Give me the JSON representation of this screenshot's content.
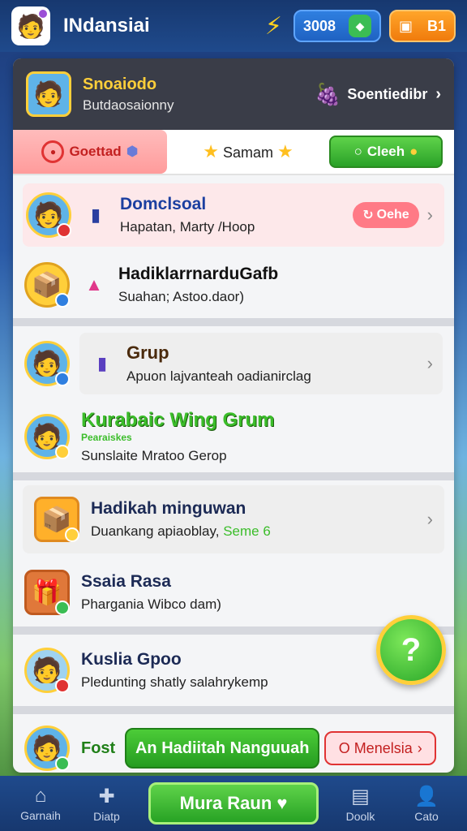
{
  "header": {
    "title": "INdansiai",
    "coins": "3008",
    "stars": "B1"
  },
  "profile": {
    "name": "Snoaiodo",
    "subtitle": "Butdaosaionny",
    "right_label": "Soentiedibr"
  },
  "tabs": {
    "active": "Goettad",
    "middle": "Samam",
    "button": "Cleeh"
  },
  "rows": [
    {
      "title": "Domclsoal",
      "subtitle": "Hapatan, Marty /Hoop",
      "badge": "Oehe"
    },
    {
      "title": "Hadiklarrnardu​Gafb",
      "subtitle": "Suahan; Astoo.daor)"
    },
    {
      "title": "Grup",
      "subtitle": "Apuon lajvanteah oadianirclag"
    },
    {
      "title": "Kurabaic Wing Grum",
      "title_small": "Pearaiskes",
      "subtitle": "Sunslaite Mratoo Gerop"
    },
    {
      "title": "Hadikah minguwan",
      "subtitle": "Duankang apiaoblay,",
      "subtitle_accent": "Seme 6"
    },
    {
      "title": "Ssaia Rasa",
      "subtitle": "Phargania Wibco dam)"
    },
    {
      "title": "Kuslia Gpoo",
      "subtitle": "Pledunting shatly salahrykemp"
    },
    {
      "title": "Fost",
      "button_primary": "An Hadiitah Nanguuah",
      "button_secondary": "O Menelsia"
    }
  ],
  "fab": {
    "label": "?"
  },
  "bottom_nav": {
    "items": [
      "Garnaih",
      "Diatp",
      "Doolk",
      "Cato"
    ],
    "cta": "Mura Raun"
  },
  "colors": {
    "primary_green": "#2aa128",
    "accent_pink": "#ff7a86",
    "nav_blue": "#17386f",
    "gold": "#ffcf3a"
  }
}
